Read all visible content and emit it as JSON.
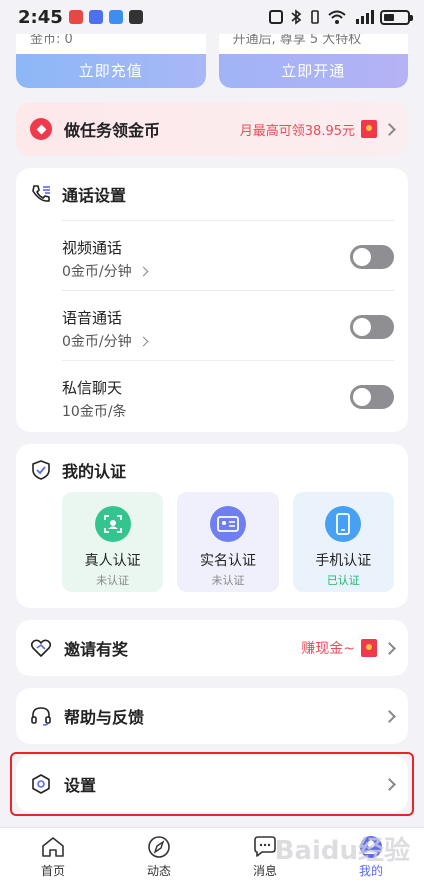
{
  "status_bar": {
    "time": "2:45"
  },
  "top_cards": {
    "left": {
      "subtext": "金币: 0",
      "button": "立即充值"
    },
    "right": {
      "subtext": "开通后, 尊享 5 大特权",
      "button": "立即开通"
    }
  },
  "task": {
    "title": "做任务领金币",
    "promo": "月最高可领38.95元"
  },
  "call_settings": {
    "title": "通话设置",
    "rows": [
      {
        "name": "视频通话",
        "price": "0金币/分钟",
        "has_chevron": true
      },
      {
        "name": "语音通话",
        "price": "0金币/分钟",
        "has_chevron": true
      },
      {
        "name": "私信聊天",
        "price": "10金币/条",
        "has_chevron": false
      }
    ]
  },
  "certification": {
    "title": "我的认证",
    "items": [
      {
        "label": "真人认证",
        "status": "未认证",
        "color": "#34c58f",
        "bg": "#eaf7f1"
      },
      {
        "label": "实名认证",
        "status": "未认证",
        "color": "#6f7ef0",
        "bg": "#eff0fb"
      },
      {
        "label": "手机认证",
        "status": "已认证",
        "color": "#48a0f3",
        "bg": "#eaf3fc"
      }
    ]
  },
  "invite": {
    "label": "邀请有奖",
    "promo": "赚现金~"
  },
  "help": {
    "label": "帮助与反馈"
  },
  "settings": {
    "label": "设置"
  },
  "tabbar": {
    "items": [
      {
        "label": "首页",
        "icon": "home-icon"
      },
      {
        "label": "动态",
        "icon": "compass-icon"
      },
      {
        "label": "消息",
        "icon": "message-icon"
      },
      {
        "label": "我的",
        "icon": "profile-icon"
      }
    ]
  },
  "watermark": "Baidu经验",
  "colors": {
    "accent": "#5b6af0",
    "promo_red": "#ee4b5b",
    "highlight": "#e8252a"
  }
}
